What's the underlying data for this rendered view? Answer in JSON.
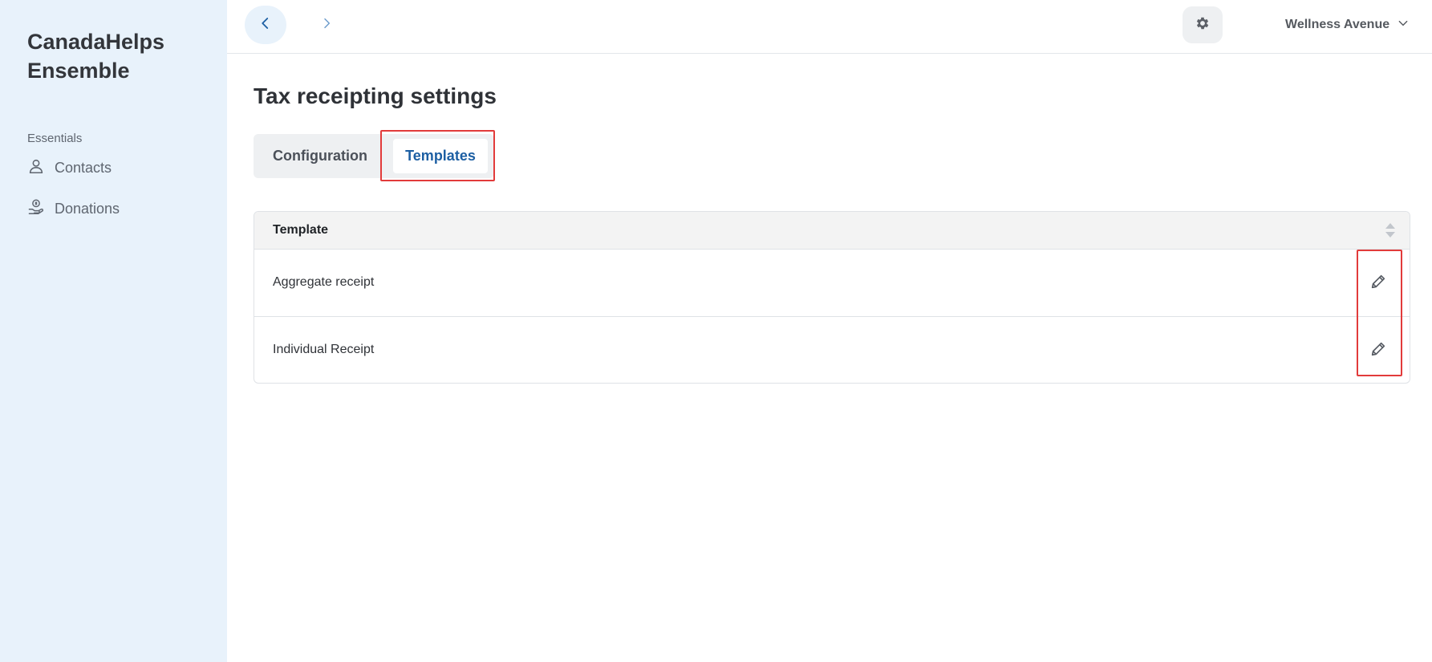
{
  "brand": {
    "line1": "CanadaHelps",
    "line2": "Ensemble"
  },
  "sidebar": {
    "section_label": "Essentials",
    "items": [
      {
        "label": "Contacts",
        "icon": "person-icon"
      },
      {
        "label": "Donations",
        "icon": "hand-donation-icon"
      }
    ]
  },
  "topbar": {
    "org_name": "Wellness Avenue",
    "icons": [
      "chevron-left-icon",
      "chevron-right-icon",
      "gear-icon",
      "chevron-down-icon"
    ]
  },
  "page": {
    "title": "Tax receipting settings",
    "tabs": [
      {
        "label": "Configuration",
        "active": false
      },
      {
        "label": "Templates",
        "active": true
      }
    ]
  },
  "table": {
    "header": "Template",
    "rows": [
      {
        "name": "Aggregate receipt"
      },
      {
        "name": "Individual Receipt"
      }
    ]
  },
  "colors": {
    "sidebar_bg": "#e8f2fb",
    "accent": "#1d5fa3",
    "highlight": "#e23b3b"
  }
}
